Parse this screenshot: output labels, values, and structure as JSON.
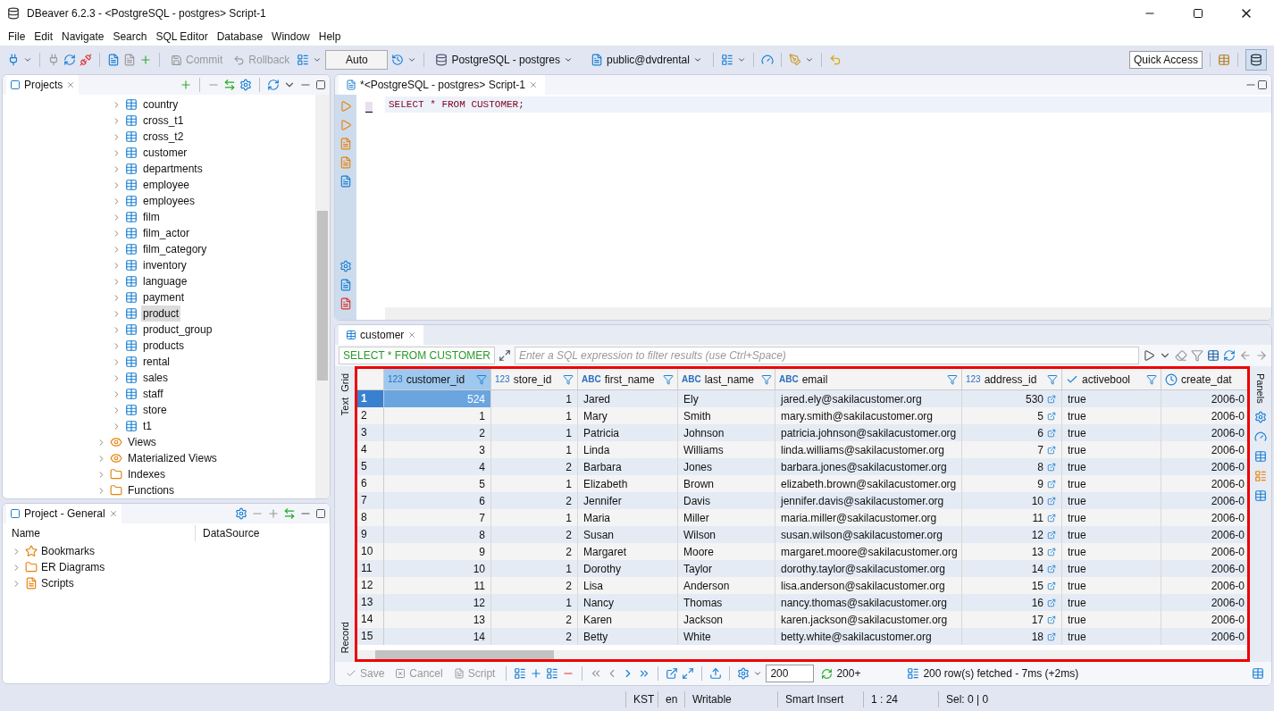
{
  "window": {
    "title": "DBeaver 6.2.3 - <PostgreSQL - postgres> Script-1"
  },
  "menu": [
    "File",
    "Edit",
    "Navigate",
    "Search",
    "SQL Editor",
    "Database",
    "Window",
    "Help"
  ],
  "toolbar": {
    "commit": "Commit",
    "rollback": "Rollback",
    "mode": "Auto",
    "connection": "PostgreSQL - postgres",
    "schema": "public@dvdrental",
    "quick_access": "Quick Access"
  },
  "projects": {
    "tab": "Projects",
    "items": [
      {
        "label": "country",
        "kind": "table",
        "selected": false
      },
      {
        "label": "cross_t1",
        "kind": "table",
        "selected": false
      },
      {
        "label": "cross_t2",
        "kind": "table",
        "selected": false
      },
      {
        "label": "customer",
        "kind": "table",
        "selected": false
      },
      {
        "label": "departments",
        "kind": "table",
        "selected": false
      },
      {
        "label": "employee",
        "kind": "table",
        "selected": false
      },
      {
        "label": "employees",
        "kind": "table",
        "selected": false
      },
      {
        "label": "film",
        "kind": "table",
        "selected": false
      },
      {
        "label": "film_actor",
        "kind": "table",
        "selected": false
      },
      {
        "label": "film_category",
        "kind": "table",
        "selected": false
      },
      {
        "label": "inventory",
        "kind": "table",
        "selected": false
      },
      {
        "label": "language",
        "kind": "table",
        "selected": false
      },
      {
        "label": "payment",
        "kind": "table",
        "selected": false
      },
      {
        "label": "product",
        "kind": "table",
        "selected": true
      },
      {
        "label": "product_group",
        "kind": "table",
        "selected": false
      },
      {
        "label": "products",
        "kind": "table",
        "selected": false
      },
      {
        "label": "rental",
        "kind": "table",
        "selected": false
      },
      {
        "label": "sales",
        "kind": "table",
        "selected": false
      },
      {
        "label": "staff",
        "kind": "table",
        "selected": false
      },
      {
        "label": "store",
        "kind": "table",
        "selected": false
      },
      {
        "label": "t1",
        "kind": "table",
        "selected": false
      },
      {
        "label": "Views",
        "kind": "views",
        "selected": false
      },
      {
        "label": "Materialized Views",
        "kind": "views",
        "selected": false
      },
      {
        "label": "Indexes",
        "kind": "folder",
        "selected": false
      },
      {
        "label": "Functions",
        "kind": "folder",
        "selected": false
      }
    ]
  },
  "project_general": {
    "tab": "Project - General",
    "columns": [
      "Name",
      "DataSource"
    ],
    "items": [
      {
        "label": "Bookmarks",
        "kind": "bookmarks"
      },
      {
        "label": "ER Diagrams",
        "kind": "diagrams"
      },
      {
        "label": "Scripts",
        "kind": "scripts"
      }
    ]
  },
  "editor": {
    "tab": "*<PostgreSQL - postgres> Script-1",
    "code": "SELECT * FROM CUSTOMER;"
  },
  "results": {
    "tab": "customer",
    "query": "SELECT * FROM CUSTOMER",
    "filter_placeholder": "Enter a SQL expression to filter results (use Ctrl+Space)",
    "side_tabs": [
      "Grid",
      "Text",
      "Record"
    ],
    "panels_tab": "Panels",
    "columns": [
      {
        "name": "customer_id",
        "kind": "number",
        "type_label": "123",
        "selected": true
      },
      {
        "name": "store_id",
        "kind": "number",
        "type_label": "123",
        "selected": false
      },
      {
        "name": "first_name",
        "kind": "text",
        "type_label": "ABC",
        "selected": false
      },
      {
        "name": "last_name",
        "kind": "text",
        "type_label": "ABC",
        "selected": false
      },
      {
        "name": "email",
        "kind": "text",
        "type_label": "ABC",
        "selected": false
      },
      {
        "name": "address_id",
        "kind": "link",
        "type_label": "123",
        "selected": false
      },
      {
        "name": "activebool",
        "kind": "bool",
        "selected": false
      },
      {
        "name": "create_dat",
        "kind": "date",
        "selected": false
      }
    ],
    "rows": [
      {
        "num": "1",
        "selected": true,
        "cells": [
          "524",
          "1",
          "Jared",
          "Ely",
          "jared.ely@sakilacustomer.org",
          "530",
          "true",
          "2006-0"
        ]
      },
      {
        "num": "2",
        "selected": false,
        "cells": [
          "1",
          "1",
          "Mary",
          "Smith",
          "mary.smith@sakilacustomer.org",
          "5",
          "true",
          "2006-0"
        ]
      },
      {
        "num": "3",
        "selected": false,
        "cells": [
          "2",
          "1",
          "Patricia",
          "Johnson",
          "patricia.johnson@sakilacustomer.org",
          "6",
          "true",
          "2006-0"
        ]
      },
      {
        "num": "4",
        "selected": false,
        "cells": [
          "3",
          "1",
          "Linda",
          "Williams",
          "linda.williams@sakilacustomer.org",
          "7",
          "true",
          "2006-0"
        ]
      },
      {
        "num": "5",
        "selected": false,
        "cells": [
          "4",
          "2",
          "Barbara",
          "Jones",
          "barbara.jones@sakilacustomer.org",
          "8",
          "true",
          "2006-0"
        ]
      },
      {
        "num": "6",
        "selected": false,
        "cells": [
          "5",
          "1",
          "Elizabeth",
          "Brown",
          "elizabeth.brown@sakilacustomer.org",
          "9",
          "true",
          "2006-0"
        ]
      },
      {
        "num": "7",
        "selected": false,
        "cells": [
          "6",
          "2",
          "Jennifer",
          "Davis",
          "jennifer.davis@sakilacustomer.org",
          "10",
          "true",
          "2006-0"
        ]
      },
      {
        "num": "8",
        "selected": false,
        "cells": [
          "7",
          "1",
          "Maria",
          "Miller",
          "maria.miller@sakilacustomer.org",
          "11",
          "true",
          "2006-0"
        ]
      },
      {
        "num": "9",
        "selected": false,
        "cells": [
          "8",
          "2",
          "Susan",
          "Wilson",
          "susan.wilson@sakilacustomer.org",
          "12",
          "true",
          "2006-0"
        ]
      },
      {
        "num": "10",
        "selected": false,
        "cells": [
          "9",
          "2",
          "Margaret",
          "Moore",
          "margaret.moore@sakilacustomer.org",
          "13",
          "true",
          "2006-0"
        ]
      },
      {
        "num": "11",
        "selected": false,
        "cells": [
          "10",
          "1",
          "Dorothy",
          "Taylor",
          "dorothy.taylor@sakilacustomer.org",
          "14",
          "true",
          "2006-0"
        ]
      },
      {
        "num": "12",
        "selected": false,
        "cells": [
          "11",
          "2",
          "Lisa",
          "Anderson",
          "lisa.anderson@sakilacustomer.org",
          "15",
          "true",
          "2006-0"
        ]
      },
      {
        "num": "13",
        "selected": false,
        "cells": [
          "12",
          "1",
          "Nancy",
          "Thomas",
          "nancy.thomas@sakilacustomer.org",
          "16",
          "true",
          "2006-0"
        ]
      },
      {
        "num": "14",
        "selected": false,
        "cells": [
          "13",
          "2",
          "Karen",
          "Jackson",
          "karen.jackson@sakilacustomer.org",
          "17",
          "true",
          "2006-0"
        ]
      },
      {
        "num": "15",
        "selected": false,
        "cells": [
          "14",
          "2",
          "Betty",
          "White",
          "betty.white@sakilacustomer.org",
          "18",
          "true",
          "2006-0"
        ]
      }
    ],
    "bottom": {
      "save": "Save",
      "cancel": "Cancel",
      "script": "Script",
      "fetch_size": "200",
      "fetch_more": "200+",
      "fetched": "200 row(s) fetched - 7ms (+2ms)"
    }
  },
  "status_bar": [
    "KST",
    "en",
    "Writable",
    "Smart Insert",
    "1 : 24",
    "Sel: 0 | 0"
  ]
}
